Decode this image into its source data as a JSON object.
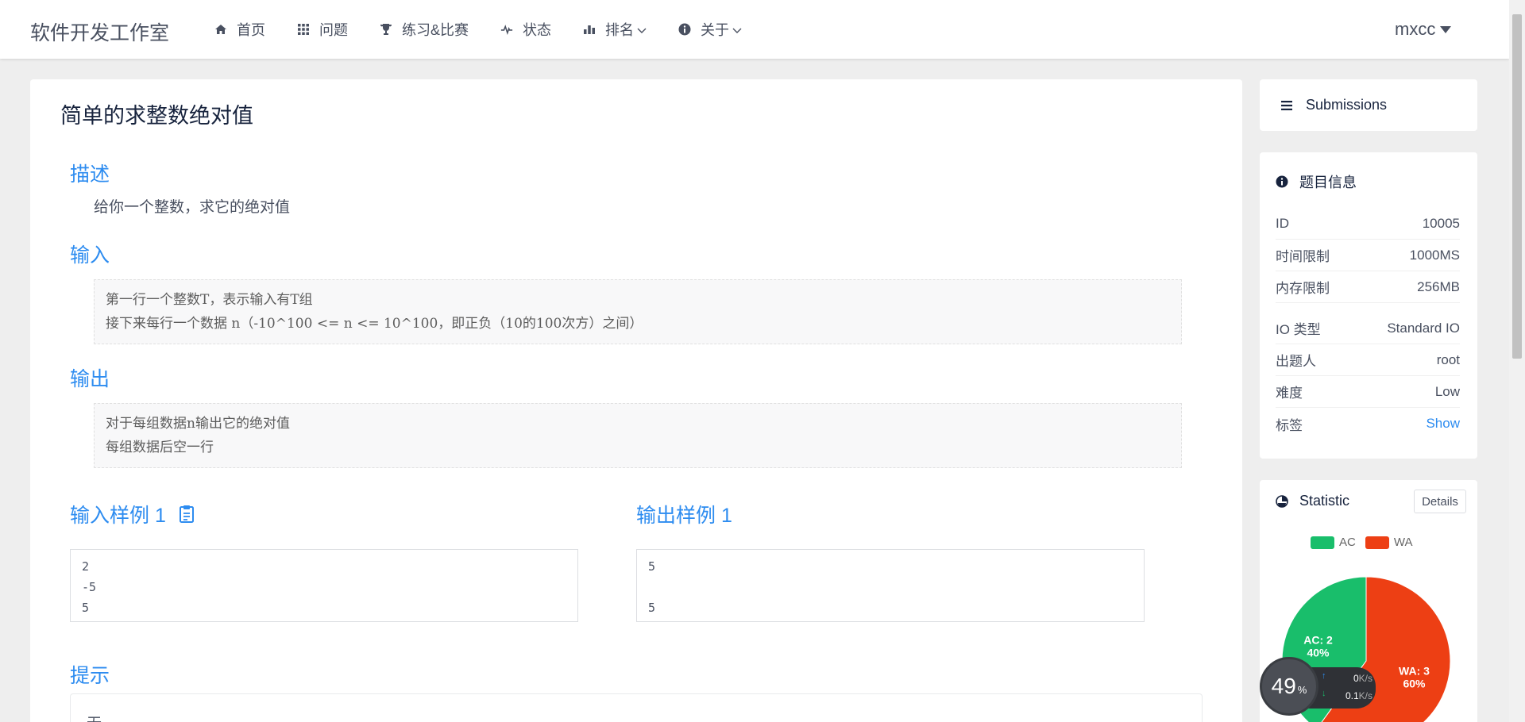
{
  "header": {
    "logo": "软件开发工作室",
    "nav": [
      {
        "label": "首页",
        "icon": "home-icon"
      },
      {
        "label": "问题",
        "icon": "grid-icon"
      },
      {
        "label": "练习&比赛",
        "icon": "trophy-icon"
      },
      {
        "label": "状态",
        "icon": "pulse-icon"
      },
      {
        "label": "排名",
        "icon": "bar-chart-icon"
      },
      {
        "label": "关于",
        "icon": "info-icon"
      }
    ],
    "user": "mxcc"
  },
  "problem": {
    "title": "简单的求整数绝对值",
    "description_heading": "描述",
    "description": "给你一个整数，求它的绝对值",
    "input_heading": "输入",
    "input_lines": [
      "第一行一个整数T，表示输入有T组",
      "接下来每行一个数据 n（-10^100 <= n <= 10^100，即正负（10的100次方）之间）"
    ],
    "output_heading": "输出",
    "output_lines": [
      "对于每组数据n输出它的绝对值",
      "每组数据后空一行"
    ],
    "sample_input_heading": "输入样例 1",
    "sample_input_lines": [
      "2",
      "-5",
      "5"
    ],
    "sample_output_heading": "输出样例 1",
    "sample_output_lines": [
      "5",
      "",
      "5"
    ],
    "hint_heading": "提示",
    "hint": "无"
  },
  "sidebar": {
    "submissions_label": "Submissions",
    "info_heading": "题目信息",
    "info": [
      {
        "key": "ID",
        "value": "10005"
      },
      {
        "key": "时间限制",
        "value": "1000MS"
      },
      {
        "key": "内存限制",
        "value": "256MB"
      },
      {
        "key": "IO 类型",
        "value": "Standard IO"
      },
      {
        "key": "出题人",
        "value": "root"
      },
      {
        "key": "难度",
        "value": "Low"
      },
      {
        "key": "标签",
        "value": "Show"
      }
    ],
    "statistic_heading": "Statistic",
    "details_label": "Details"
  },
  "chart_data": {
    "type": "pie",
    "categories": [
      "AC",
      "WA"
    ],
    "values": [
      2,
      3
    ],
    "labels": [
      {
        "name": "AC: 2",
        "percent": "40%"
      },
      {
        "name": "WA: 3",
        "percent": "60%"
      }
    ],
    "colors": [
      "#19be6b",
      "#ed3f14"
    ],
    "legend": "top"
  },
  "widget": {
    "percent": "49",
    "percent_unit": "%",
    "up_value": "0",
    "up_unit": "K/s",
    "down_value": "0.1",
    "down_unit": "K/s"
  }
}
